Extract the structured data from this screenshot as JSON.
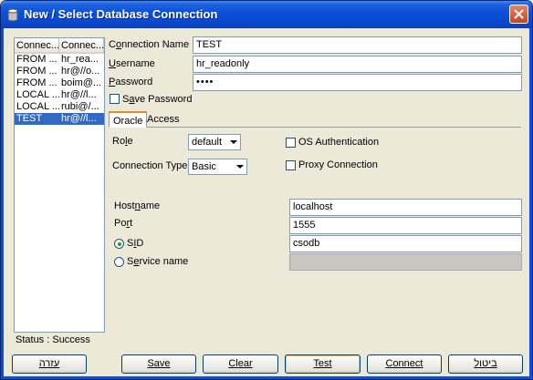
{
  "window": {
    "title": "New / Select Database Connection"
  },
  "connections": {
    "headers": [
      "Connec...",
      "Connec..."
    ],
    "rows": [
      [
        "FROM ...",
        "hr_rea..."
      ],
      [
        "FROM ...",
        "hr@//o..."
      ],
      [
        "FROM ...",
        "boim@..."
      ],
      [
        "LOCAL ...",
        "hr@//l..."
      ],
      [
        "LOCAL ...",
        "rubi@/..."
      ],
      [
        "TEST",
        "hr@//l..."
      ]
    ],
    "selected_index": 5
  },
  "status": "Status : Success",
  "form": {
    "connection_name": {
      "label_pre": "C",
      "label_u": "o",
      "label_post": "nnection Name",
      "value": "TEST"
    },
    "username": {
      "label_u": "U",
      "label_post": "sername",
      "value": "hr_readonly"
    },
    "password": {
      "label_u": "P",
      "label_post": "assword",
      "value": "••••"
    },
    "save_password": {
      "label_pre": "S",
      "label_u": "a",
      "label_post": "ve Password",
      "checked": false
    }
  },
  "tabs": {
    "oracle": "Oracle",
    "access": "Access",
    "active": "oracle"
  },
  "oracle": {
    "role": {
      "label": "Role",
      "label_u": "l",
      "value": "default"
    },
    "connection_type": {
      "label": "Connection Type",
      "value": "Basic"
    },
    "os_auth": {
      "label": "OS Authentication",
      "checked": false
    },
    "proxy": {
      "label": "Proxy Connection",
      "checked": false
    },
    "hostname": {
      "label_pre": "Host",
      "label_u": "n",
      "label_post": "ame",
      "value": "localhost"
    },
    "port": {
      "label_pre": "Po",
      "label_u": "r",
      "label_post": "t",
      "value": "1555"
    },
    "sid": {
      "label_pre": "S",
      "label_u": "I",
      "label_post": "D",
      "value": "csodb",
      "selected": true
    },
    "service_name": {
      "label_pre": "S",
      "label_u": "e",
      "label_post": "rvice name",
      "value": "",
      "selected": false
    }
  },
  "buttons": {
    "help": "עזרה",
    "save": "Save",
    "clear": "Clear",
    "test": "Test",
    "connect": "Connect",
    "cancel": "ביטול"
  }
}
